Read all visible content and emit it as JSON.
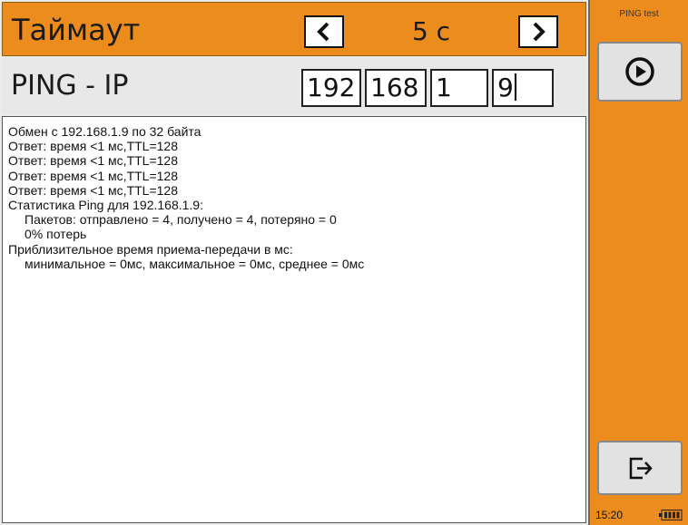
{
  "timeout": {
    "label": "Таймаут",
    "value": "5 с",
    "prev_icon": "chevron-left-icon",
    "next_icon": "chevron-right-icon"
  },
  "ping": {
    "label": "PING - IP",
    "octets": [
      "192",
      "168",
      "1",
      "9"
    ]
  },
  "output": {
    "lines": [
      "Обмен с 192.168.1.9 по 32 байта",
      "Ответ: время <1 мс,TTL=128",
      "Ответ: время <1 мс,TTL=128",
      "Ответ: время <1 мс,TTL=128",
      "Ответ: время <1 мс,TTL=128",
      "Статистика Ping для 192.168.1.9:",
      "Пакетов: отправлено = 4, получено = 4, потеряно = 0",
      "0% потерь",
      "Приблизительное время приема-передачи в мс:",
      "минимальное = 0мс, максимальное = 0мс, среднее = 0мс"
    ]
  },
  "side": {
    "title": "PING test",
    "run_icon": "play-circle-icon",
    "exit_icon": "exit-icon"
  },
  "status": {
    "time": "15:20",
    "battery_icon": "battery-icon"
  },
  "colors": {
    "accent": "#ec8c1c",
    "panel": "#ebebeb",
    "button": "#e2e2e2"
  }
}
